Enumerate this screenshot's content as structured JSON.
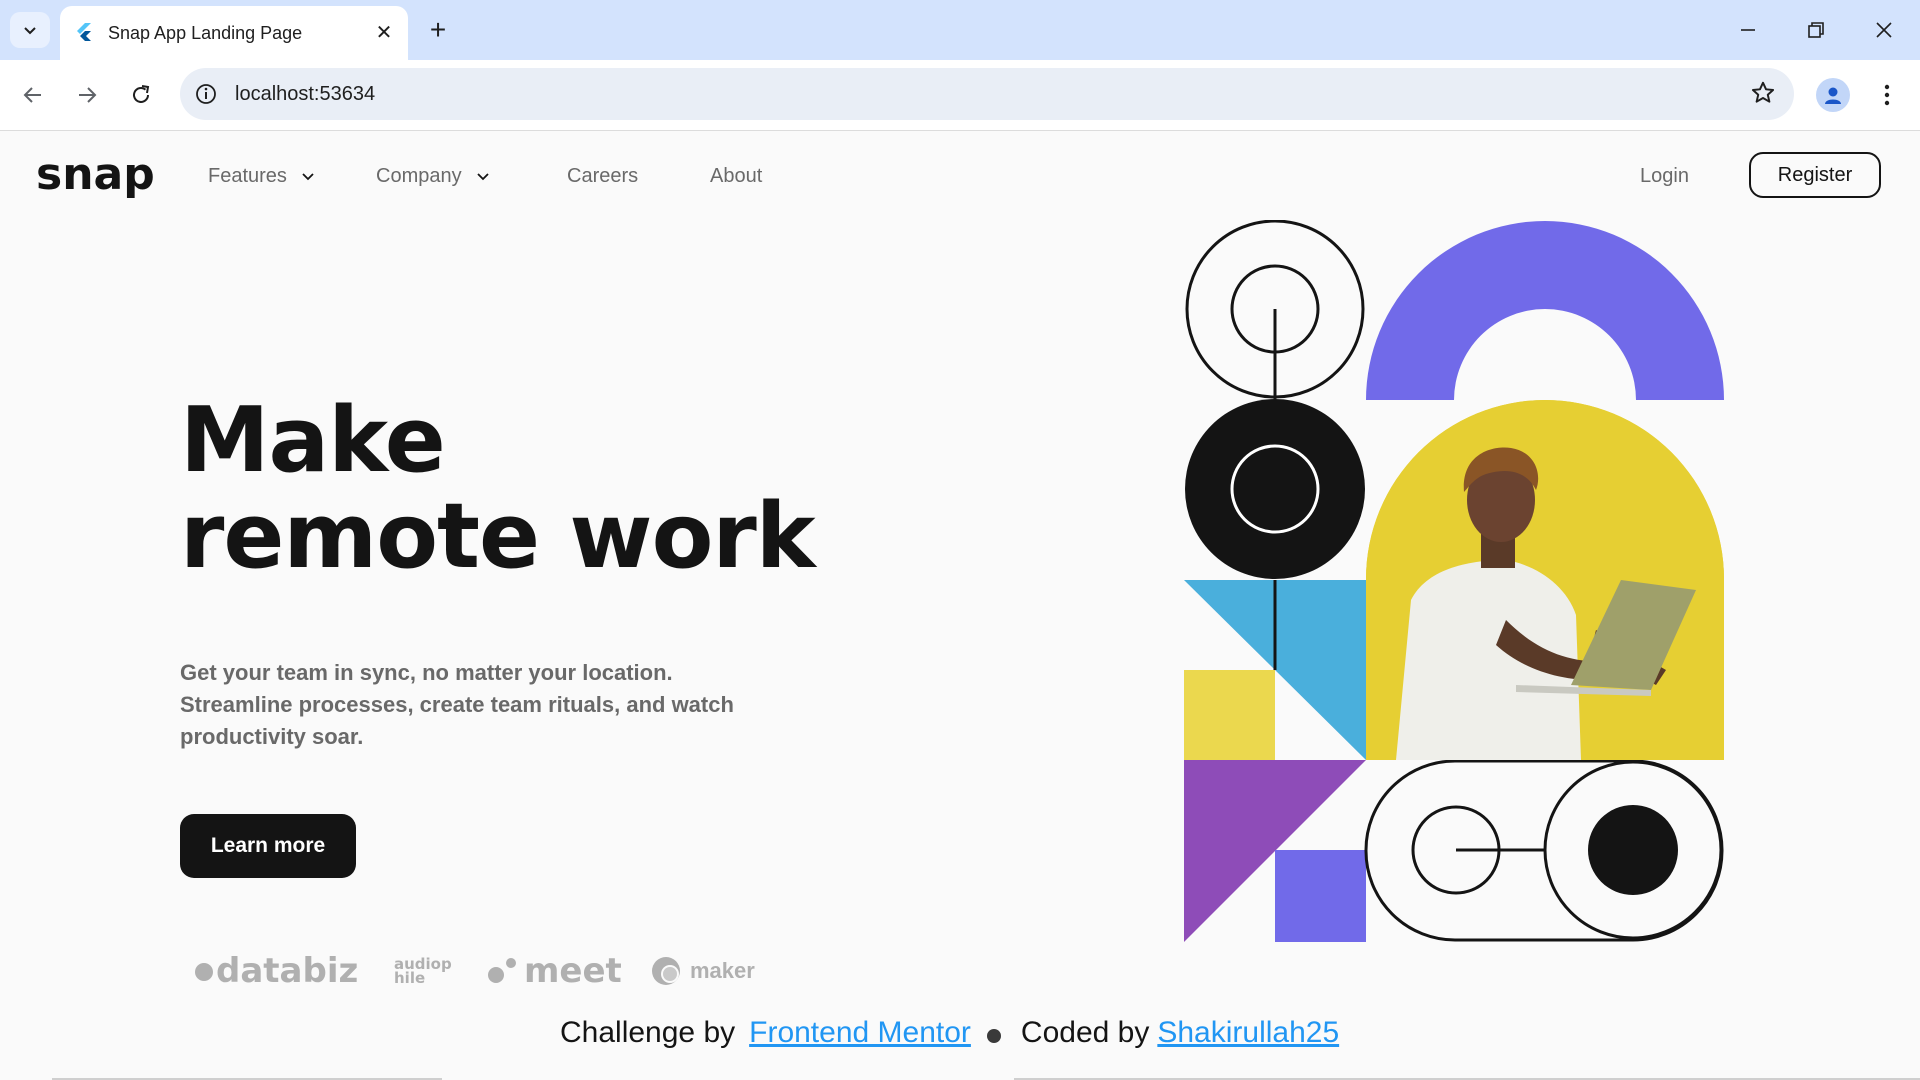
{
  "browser": {
    "tab_title": "Snap App Landing Page",
    "url": "localhost:53634",
    "new_tab_symbol": "+",
    "close_symbol": "✕"
  },
  "nav": {
    "logo": "snap",
    "features": "Features",
    "company": "Company",
    "careers": "Careers",
    "about": "About",
    "login": "Login",
    "register": "Register"
  },
  "hero": {
    "title_line1": "Make",
    "title_line2": "remote work",
    "description": "Get your team in sync, no matter your location. Streamline processes, create team rituals, and watch productivity soar.",
    "cta": "Learn more"
  },
  "clients": [
    "databiz",
    "audiophile",
    "meet",
    "maker"
  ],
  "footer": {
    "challenge_prefix": "Challenge by",
    "challenge_link": "Frontend Mentor",
    "coded_prefix": "Coded by",
    "coded_link": "Shakirullah25"
  },
  "colors": {
    "accent_purple": "#716ae9",
    "blue": "#4aafdc",
    "yellow": "#ebd84e",
    "violet": "#8e4cb8",
    "dark": "#141414",
    "link": "#2196f3"
  }
}
